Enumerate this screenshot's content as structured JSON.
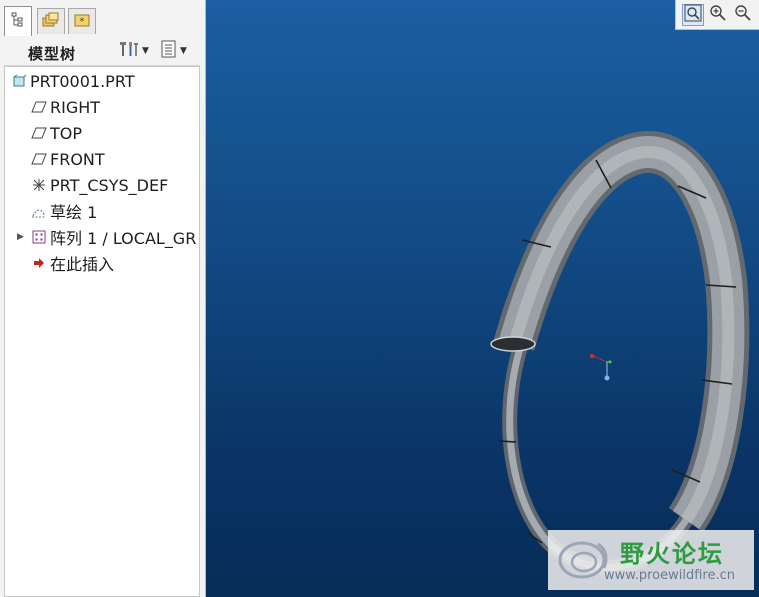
{
  "panel": {
    "tabs": [
      {
        "name": "model-tree-tab",
        "icon": "model-tree-icon"
      },
      {
        "name": "folder-browser-tab",
        "icon": "folder-icon"
      },
      {
        "name": "favorites-tab",
        "icon": "favorites-icon"
      }
    ],
    "title": "模型树",
    "header_icons": [
      "settings-tools-icon",
      "show-columns-icon"
    ]
  },
  "tree": {
    "items": [
      {
        "label": "PRT0001.PRT",
        "icon": "part-icon"
      },
      {
        "label": "RIGHT",
        "icon": "datum-plane-icon"
      },
      {
        "label": "TOP",
        "icon": "datum-plane-icon"
      },
      {
        "label": "FRONT",
        "icon": "datum-plane-icon"
      },
      {
        "label": "PRT_CSYS_DEF",
        "icon": "coordinate-system-icon"
      },
      {
        "label": "草绘 1",
        "icon": "sketch-icon"
      },
      {
        "label": "阵列 1 / LOCAL_GR",
        "icon": "pattern-icon"
      },
      {
        "label": "在此插入",
        "icon": "insert-here-arrow-icon"
      }
    ]
  },
  "view_toolbar": {
    "icons": [
      "refit-icon",
      "zoom-in-icon",
      "zoom-out-icon"
    ]
  },
  "watermark": {
    "title": "野火论坛",
    "url": "www.proewildfire.cn"
  },
  "colors": {
    "viewport_top": "#1b5fa2",
    "viewport_bottom": "#072c58",
    "model_gray": "#8c9299",
    "watermark_green": "#2d9b42"
  }
}
